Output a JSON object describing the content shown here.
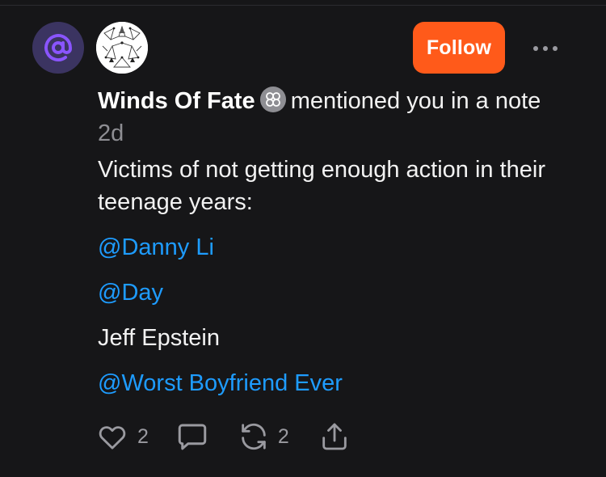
{
  "notification": {
    "author": "Winds Of Fate",
    "action_text": "mentioned you in a note",
    "time": "2d",
    "follow_label": "Follow"
  },
  "note": {
    "paragraphs": [
      {
        "text": "Victims of not getting enough action in their teenage years:",
        "is_mention": false
      },
      {
        "text": "@Danny Li",
        "is_mention": true
      },
      {
        "text": "@Day",
        "is_mention": true
      },
      {
        "text": "Jeff Epstein",
        "is_mention": false
      },
      {
        "text": "@Worst Boyfriend Ever",
        "is_mention": true
      }
    ]
  },
  "actions": {
    "like_count": "2",
    "restack_count": "2"
  },
  "icons": {
    "mention": "at-sign-icon",
    "badge": "flower-badge-icon",
    "more": "ellipsis-icon",
    "like": "heart-icon",
    "comment": "comment-bubble-icon",
    "restack": "restack-icon",
    "share": "share-icon"
  },
  "colors": {
    "background": "#161618",
    "accent": "#ff5a1a",
    "link": "#1e9cff",
    "muted": "#8e8e93",
    "mention_badge_bg": "#3b3461",
    "mention_icon": "#8a55ff"
  }
}
